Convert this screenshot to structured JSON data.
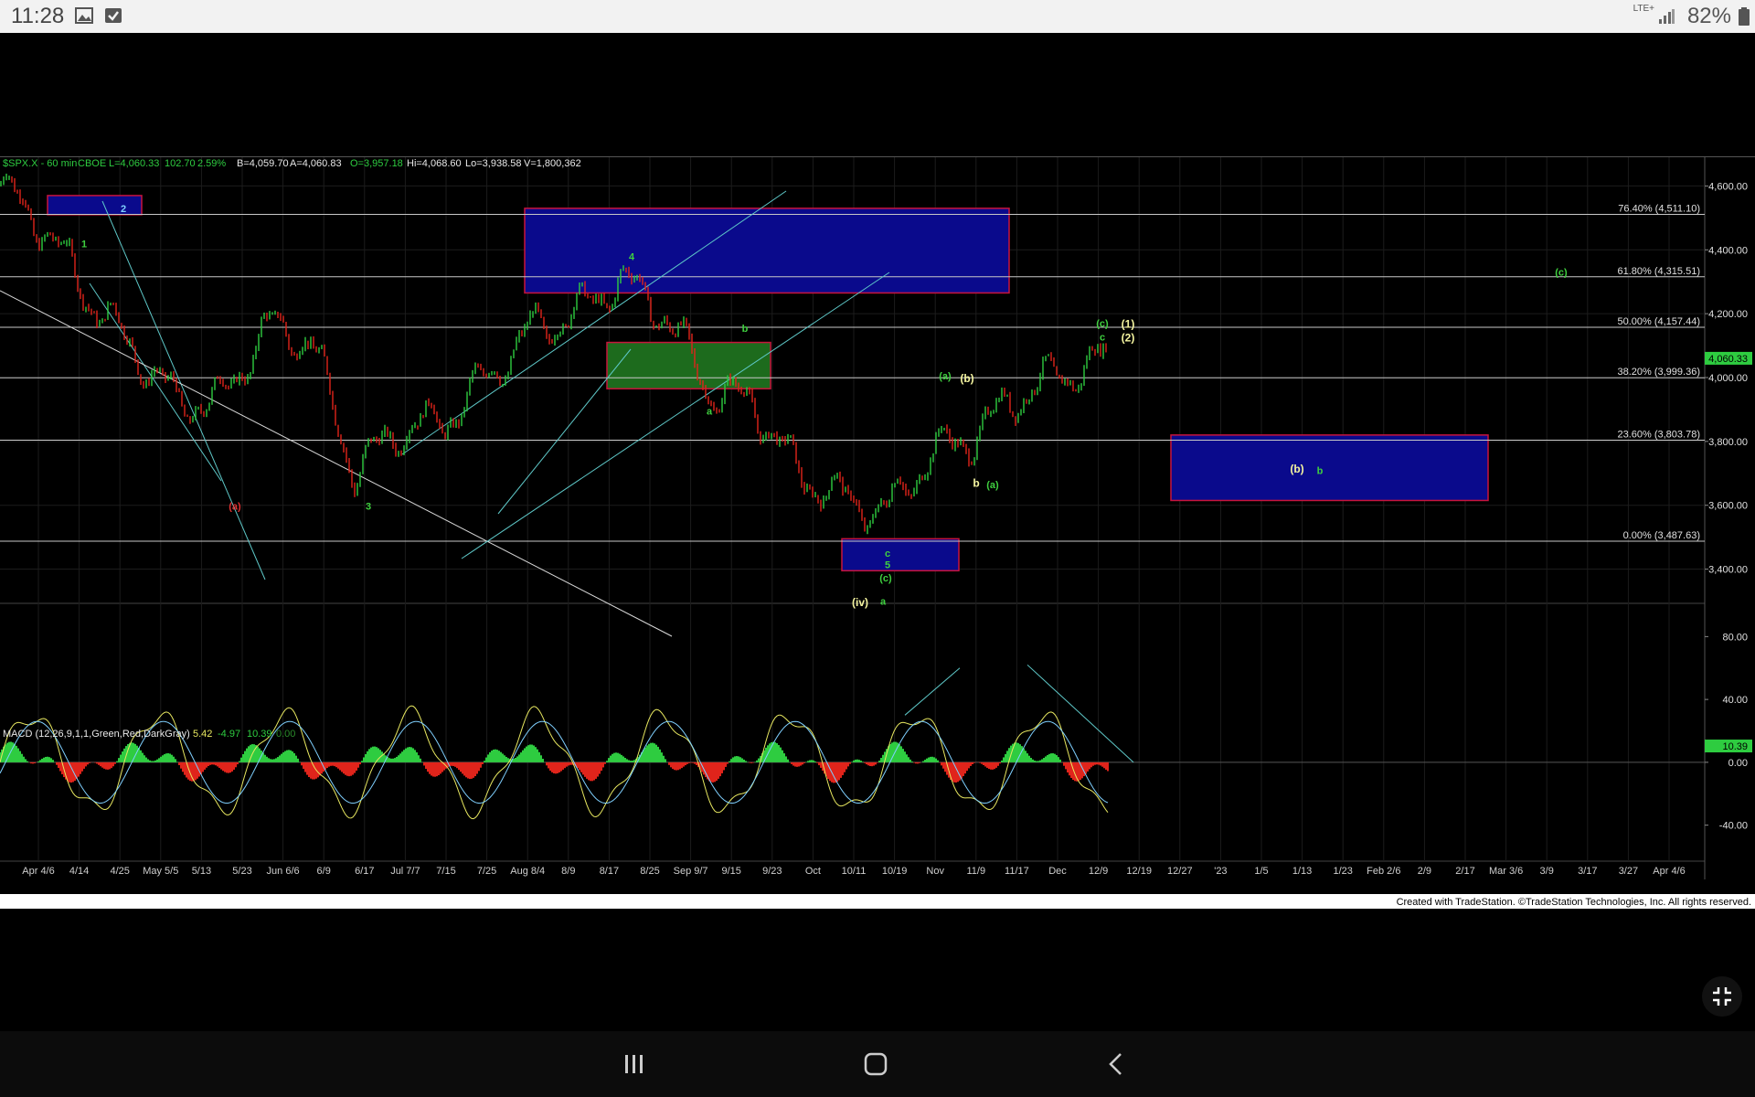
{
  "status_bar": {
    "time": "11:28",
    "network": "LTE+",
    "battery": "82%",
    "icons": [
      "image-icon",
      "check-icon",
      "signal-icon",
      "battery-icon"
    ]
  },
  "header": {
    "symbol": "$SPX.X - 60 min",
    "exchange": "CBOE",
    "last": "L=4,060.33",
    "change": "102.70",
    "change_pct": "2.59%",
    "bid": "B=4,059.70",
    "ask": "A=4,060.83",
    "open": "O=3,957.18",
    "high": "Hi=4,068.60",
    "low": "Lo=3,938.58",
    "volume": "V=1,800,362"
  },
  "macd_header": {
    "label": "MACD (12,26,9,1,1,Green,Red,DarkGray)",
    "v1": "5.42",
    "v2": "-4.97",
    "v3": "10.39",
    "v4": "0.00"
  },
  "price_axis": [
    "4,600.00",
    "4,400.00",
    "4,200.00",
    "4,000.00",
    "3,800.00",
    "3,600.00",
    "3,400.00"
  ],
  "price_marker": "4,060.33",
  "macd_axis": [
    "80.00",
    "40.00",
    "0.00",
    "-40.00"
  ],
  "macd_marker": "10.39",
  "fib_levels": [
    {
      "label": "76.40% (4,511.10)",
      "value": 4511.1
    },
    {
      "label": "61.80% (4,315.51)",
      "value": 4315.51
    },
    {
      "label": "50.00% (4,157.44)",
      "value": 4157.44
    },
    {
      "label": "38.20% (3,999.36)",
      "value": 3999.36
    },
    {
      "label": "23.60% (3,803.78)",
      "value": 3803.78
    },
    {
      "label": "0.00% (3,487.63)",
      "value": 3487.63
    }
  ],
  "date_axis": [
    "Apr 4/6",
    "4/14",
    "4/25",
    "May 5/5",
    "5/13",
    "5/23",
    "Jun 6/6",
    "6/9",
    "6/17",
    "Jul 7/7",
    "7/15",
    "7/25",
    "Aug 8/4",
    "8/9",
    "8/17",
    "8/25",
    "Sep 9/7",
    "9/15",
    "9/23",
    "Oct",
    "10/11",
    "10/19",
    "Nov",
    "11/9",
    "11/17",
    "Dec",
    "12/9",
    "12/19",
    "12/27",
    "'23",
    "1/5",
    "1/13",
    "1/23",
    "Feb 2/6",
    "2/9",
    "2/17",
    "Mar 3/6",
    "3/9",
    "3/17",
    "3/27",
    "Apr 4/6"
  ],
  "wave_labels": [
    "1",
    "2",
    "(a)",
    "3",
    "4",
    "a",
    "b",
    "c",
    "5",
    "(c)",
    "(iv)",
    "a",
    "(a)",
    "(b)",
    "b",
    "(a)",
    "c",
    "(1)",
    "(c)",
    "(2)",
    "(b)",
    "b",
    "(c)"
  ],
  "credit": "Created with TradeStation. ©TradeStation Technologies, Inc. All rights reserved.",
  "colors": {
    "background": "#000000",
    "zone_blue": "#0a0a8c",
    "zone_green": "#1d6b1d",
    "zone_border": "#c8143c",
    "bullish": "#2ecc40",
    "bearish": "#e0241b",
    "fib_line": "#c8c8c8",
    "label_yellow": "#f5f5a0",
    "label_green": "#3fd03f",
    "label_red": "#e03030",
    "trendline": "#5ec8c8"
  },
  "chart_data": {
    "type": "line",
    "title": "$SPX.X - 60 min",
    "xlabel": "",
    "ylabel": "",
    "ylim": [
      3330,
      4690
    ],
    "x": [
      "Apr 4/6",
      "4/14",
      "4/25",
      "May 5/5",
      "5/13",
      "5/23",
      "Jun 6/6",
      "6/9",
      "6/17",
      "Jul 7/7",
      "7/15",
      "7/25",
      "Aug 8/4",
      "8/9",
      "8/17",
      "8/25",
      "Sep 9/7",
      "9/15",
      "9/23",
      "Oct",
      "10/11",
      "10/19",
      "Nov",
      "11/9",
      "11/17",
      "Dec"
    ],
    "series": [
      {
        "values": [
          4600,
          4470,
          4250,
          4090,
          3920,
          3930,
          4160,
          4120,
          3700,
          3840,
          3860,
          4000,
          4150,
          4200,
          4310,
          4200,
          3960,
          3920,
          3700,
          3620,
          3580,
          3760,
          3820,
          3950,
          4010,
          4060
        ]
      }
    ],
    "grid": true,
    "legend": "none"
  }
}
